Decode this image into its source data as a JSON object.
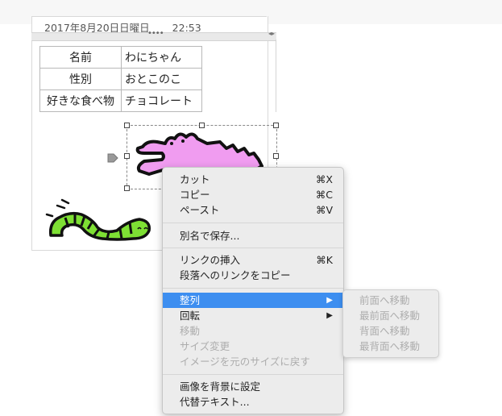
{
  "note": {
    "date": "2017年8月20日日曜日",
    "time": "22:53"
  },
  "profile_table": [
    {
      "key": "名前",
      "value": "わにちゃん"
    },
    {
      "key": "性別",
      "value": "おとこのこ"
    },
    {
      "key": "好きな食べ物",
      "value": "チョコレート"
    }
  ],
  "handlebar": {
    "dots": "••••",
    "arrows": "◂▸"
  },
  "context_menu": {
    "cut": {
      "label": "カット",
      "shortcut": "⌘X"
    },
    "copy": {
      "label": "コピー",
      "shortcut": "⌘C"
    },
    "paste": {
      "label": "ペースト",
      "shortcut": "⌘V"
    },
    "save_as": {
      "label": "別名で保存..."
    },
    "insert_link": {
      "label": "リンクの挿入",
      "shortcut": "⌘K"
    },
    "copy_paragraph_link": {
      "label": "段落へのリンクをコピー"
    },
    "arrange": {
      "label": "整列",
      "arrow": "▶"
    },
    "rotate": {
      "label": "回転",
      "arrow": "▶"
    },
    "move": {
      "label": "移動"
    },
    "resize": {
      "label": "サイズ変更"
    },
    "restore_size": {
      "label": "イメージを元のサイズに戻す"
    },
    "set_background": {
      "label": "画像を背景に設定"
    },
    "alt_text": {
      "label": "代替テキスト..."
    }
  },
  "arrange_submenu": [
    {
      "label": "前面へ移動"
    },
    {
      "label": "最前面へ移動"
    },
    {
      "label": "背面へ移動"
    },
    {
      "label": "最背面へ移動"
    }
  ],
  "colors": {
    "highlight": "#3d8ef0",
    "croc_fill": "#f09cf0",
    "worm_fill": "#7ee034",
    "menu_bg": "#ececec",
    "disabled_text": "#adadad"
  },
  "images": {
    "crocodile": "pink-crocodile-drawing",
    "worm": "green-caterpillar-drawing"
  }
}
